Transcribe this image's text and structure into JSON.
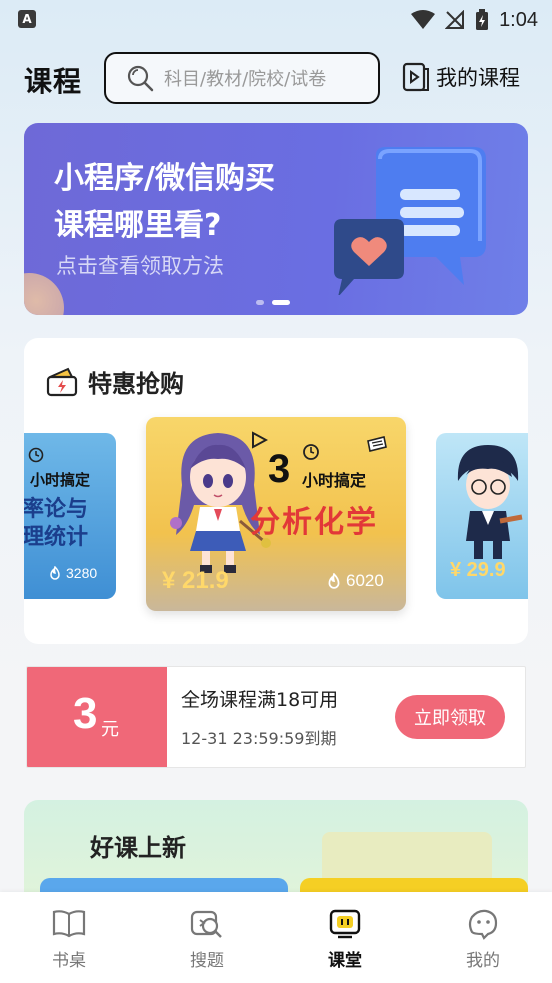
{
  "status_bar": {
    "time": "1:04",
    "left_icon_letter": "A",
    "icons": [
      "wifi-icon",
      "no-signal-icon",
      "battery-charging-icon"
    ]
  },
  "header": {
    "brand": "课程",
    "search_placeholder": "科目/教材/院校/试卷",
    "my_course_label": "我的课程"
  },
  "banner": {
    "line1": "小程序/微信购买",
    "line2": "课程哪里看?",
    "line3": "点击查看领取方法",
    "active_slide": 2,
    "slide_count": 2
  },
  "flash_sale": {
    "title": "特惠抢购",
    "courses": [
      {
        "tag": "小时搞定",
        "title_line1": "率论与",
        "title_line2": "理统计",
        "count": "3280"
      },
      {
        "tag_num": "3",
        "tag": "小时搞定",
        "title": "分析化学",
        "price": "¥ 21.9",
        "count": "6020"
      },
      {
        "price": "¥ 29.9"
      }
    ]
  },
  "coupon": {
    "amount": "3",
    "unit": "元",
    "condition": "全场课程满18可用",
    "expiry": "12-31 23:59:59到期",
    "button": "立即领取"
  },
  "new_courses": {
    "title": "好课上新"
  },
  "bottom_nav": {
    "items": [
      {
        "label": "书桌",
        "icon": "book-icon",
        "active": false
      },
      {
        "label": "搜题",
        "icon": "search-question-icon",
        "active": false
      },
      {
        "label": "课堂",
        "icon": "classroom-icon",
        "active": true
      },
      {
        "label": "我的",
        "icon": "profile-icon",
        "active": false
      }
    ]
  },
  "colors": {
    "banner": "#6a6ee2",
    "coupon": "#f06878",
    "sale_card": "#f2c24e",
    "price": "#ffd86a"
  }
}
